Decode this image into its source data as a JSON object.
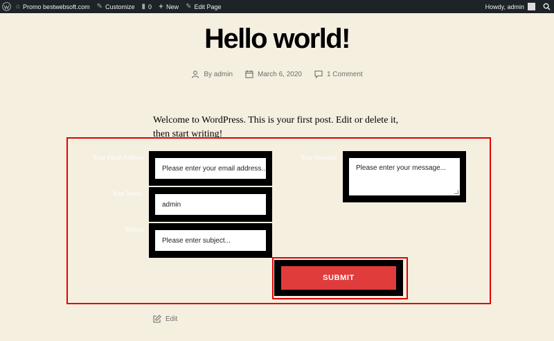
{
  "adminbar": {
    "site_name": "Promo bestwebsoft.com",
    "customize": "Customize",
    "comments_count": "0",
    "new_label": "New",
    "edit_page": "Edit Page",
    "howdy": "Howdy, admin"
  },
  "post": {
    "title": "Hello world!",
    "author": "By admin",
    "date": "March 6, 2020",
    "comments": "1 Comment",
    "intro": "Welcome to WordPress. This is your first post. Edit or delete it, then start writing!",
    "edit_label": "Edit"
  },
  "form": {
    "email_label": "Your Email Address:",
    "email_placeholder": "Please enter your email address...",
    "name_label": "Your Name:",
    "name_value": "admin",
    "subject_label": "Subject:",
    "subject_placeholder": "Please enter subject...",
    "message_label": "Your Message:",
    "message_placeholder": "Please enter your message...",
    "submit_label": "SUBMIT"
  },
  "colors": {
    "adminbar_bg": "#1d2327",
    "page_bg": "#f5efe0",
    "accent_red": "#e03c3c",
    "highlight_outline": "#e20000"
  }
}
